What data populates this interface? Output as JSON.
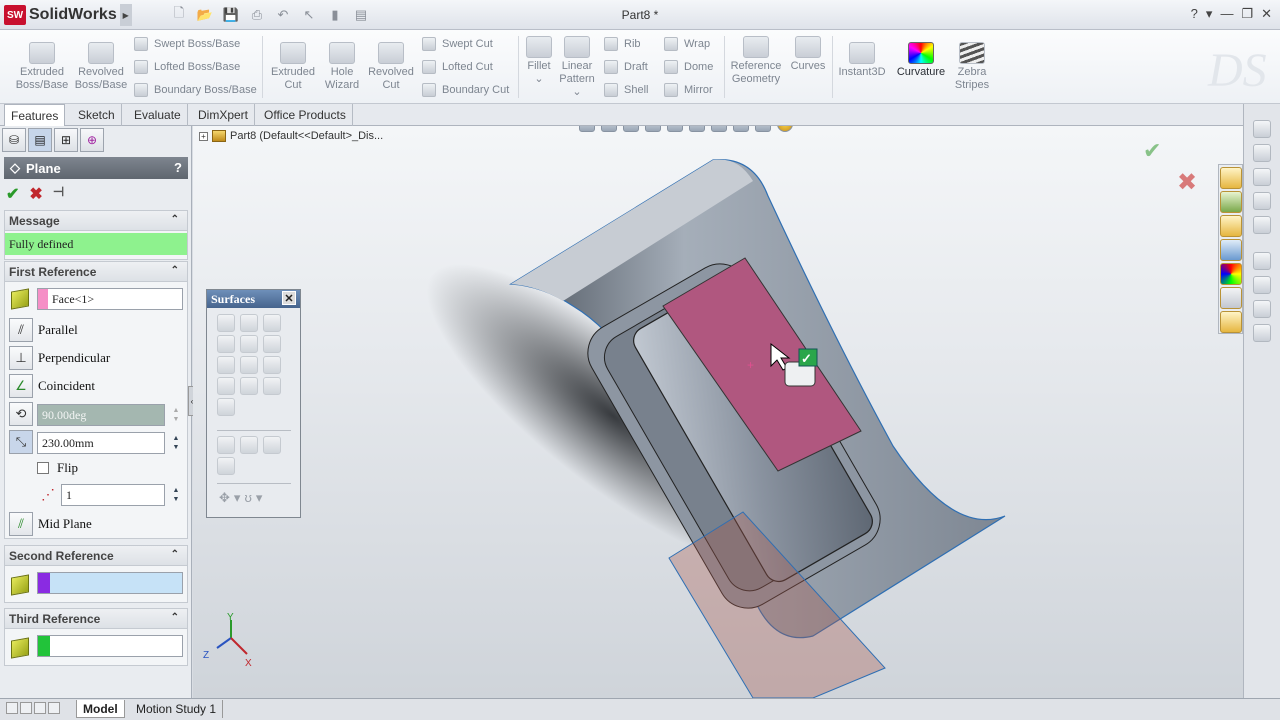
{
  "app": {
    "logo_text": "SolidWorks",
    "logo_badge": "SW",
    "document_title": "Part8 *"
  },
  "title_controls": {
    "help": "?",
    "minimize": "—",
    "restore": "❐",
    "close": "✕"
  },
  "ribbon": {
    "extruded_boss": "Extruded Boss/Base",
    "revolved_boss": "Revolved Boss/Base",
    "swept_boss": "Swept Boss/Base",
    "lofted_boss": "Lofted Boss/Base",
    "boundary_boss": "Boundary Boss/Base",
    "extruded_cut": "Extruded Cut",
    "hole_wizard": "Hole Wizard",
    "revolved_cut": "Revolved Cut",
    "swept_cut": "Swept Cut",
    "lofted_cut": "Lofted Cut",
    "boundary_cut": "Boundary Cut",
    "fillet": "Fillet",
    "linear_pattern": "Linear Pattern",
    "rib": "Rib",
    "draft": "Draft",
    "shell": "Shell",
    "wrap": "Wrap",
    "dome": "Dome",
    "mirror": "Mirror",
    "reference_geometry": "Reference Geometry",
    "curves": "Curves",
    "instant3d": "Instant3D",
    "curvature": "Curvature",
    "zebra_stripes": "Zebra Stripes"
  },
  "tabs": [
    "Features",
    "Sketch",
    "Evaluate",
    "DimXpert",
    "Office Products"
  ],
  "pm": {
    "title": "Plane",
    "help": "?",
    "message_header": "Message",
    "message": "Fully defined",
    "message_color": "#8ef28e",
    "first_ref_header": "First Reference",
    "first_ref_value": "Face<1>",
    "first_ref_color": "#f58fc6",
    "parallel": "Parallel",
    "perpendicular": "Perpendicular",
    "coincident": "Coincident",
    "angle_value": "90.00deg",
    "distance_value": "230.00mm",
    "flip": "Flip",
    "instances": "1",
    "mid_plane": "Mid Plane",
    "second_ref_header": "Second Reference",
    "second_ref_color": "#8a2be2",
    "third_ref_header": "Third Reference",
    "third_ref_color": "#22c33a"
  },
  "surfaces": {
    "title": "Surfaces",
    "close": "✕"
  },
  "viewport": {
    "tree_label": "Part8  (Default<<Default>_Dis...",
    "plane_color": "#a6584e",
    "face_color": "#b0577f",
    "axis_z": "Z",
    "axis_y": "Y",
    "axis_x": "X"
  },
  "bottom_tabs": [
    "Model",
    "Motion Study 1"
  ]
}
